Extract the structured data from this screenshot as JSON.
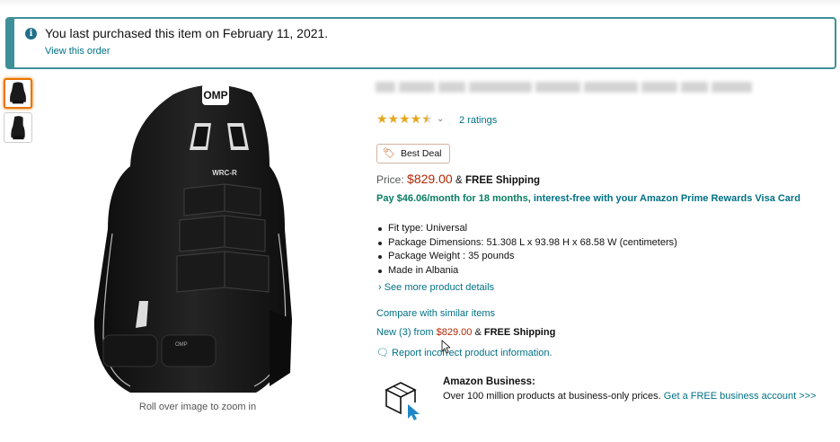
{
  "alert": {
    "icon": "info-icon",
    "message": "You last purchased this item on February 11, 2021.",
    "link": "View this order"
  },
  "gallery": {
    "thumbnails": [
      {
        "name": "seat-front-thumbnail",
        "selected": true
      },
      {
        "name": "seat-angle-thumbnail",
        "selected": false
      }
    ],
    "main_image_logo": "OMP",
    "seat_model_label": "WRC-R",
    "zoom_hint": "Roll over image to zoom in"
  },
  "product": {
    "rating_stars": 4.5,
    "ratings_count": "2 ratings",
    "badge": "Best Deal",
    "price_label": "Price:",
    "price": "$829.00",
    "price_amp": "&",
    "price_shipping": "FREE Shipping",
    "finance": {
      "prefix": "Pay $46.06/month for 18 months,",
      "suffix": " interest-free with your Amazon Prime Rewards Visa Card"
    },
    "bullets": [
      "Fit type: Universal",
      "Package Dimensions: 51.308 L x 93.98 H x 68.58 W (centimeters)",
      "Package Weight : 35 pounds",
      "Made in Albania"
    ],
    "see_more": "› See more product details",
    "compare": "Compare with similar items",
    "new_from": {
      "label": "New (3) from",
      "price": "$829.00",
      "amp": "&",
      "shipping": "FREE Shipping"
    },
    "report": "Report incorrect product information."
  },
  "business": {
    "icon": "box-cursor-icon",
    "title": "Amazon Business:",
    "text": "Over 100 million products at business-only prices.",
    "link": "Get a FREE business account >>>"
  },
  "colors": {
    "link": "#007185",
    "price": "#b12704",
    "star": "#e5a61c",
    "alert_border": "#3f8f99"
  }
}
